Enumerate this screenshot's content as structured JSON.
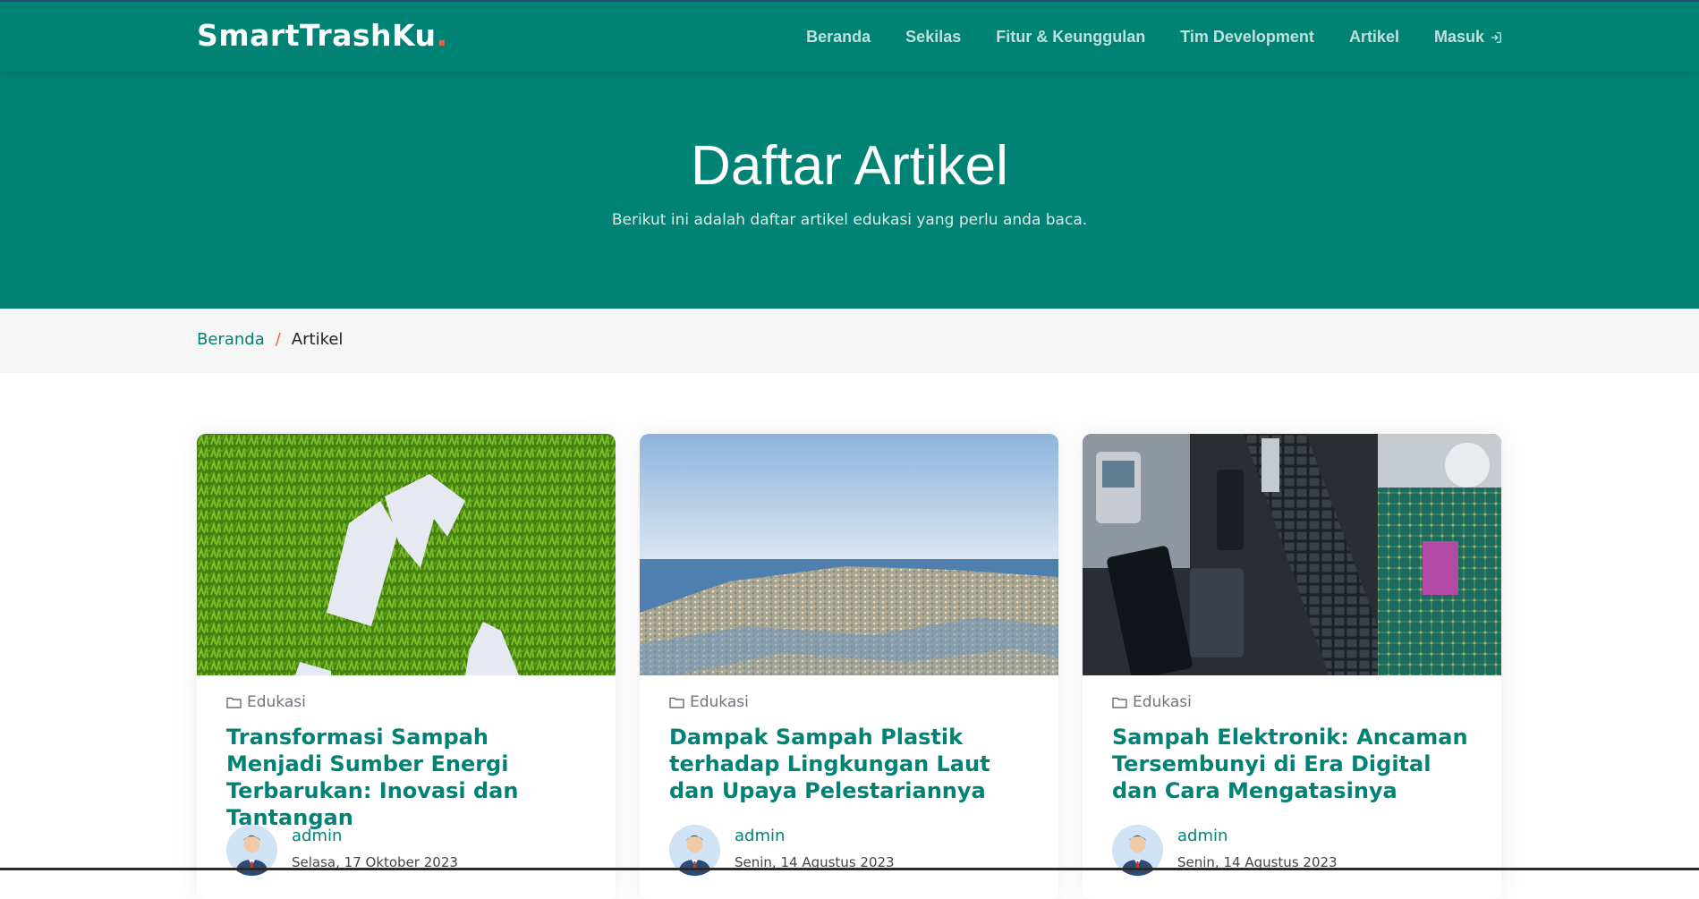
{
  "brand": {
    "name": "SmartTrashKu",
    "dot": ".",
    "accent": "#f85a40",
    "primary": "#008374"
  },
  "nav": {
    "items": [
      {
        "label": "Beranda"
      },
      {
        "label": "Sekilas"
      },
      {
        "label": "Fitur & Keunggulan"
      },
      {
        "label": "Tim Development"
      },
      {
        "label": "Artikel"
      },
      {
        "label": "Masuk",
        "icon": "login-icon"
      }
    ]
  },
  "hero": {
    "title": "Daftar Artikel",
    "subtitle": "Berikut ini adalah daftar artikel edukasi yang perlu anda baca."
  },
  "breadcrumb": {
    "home": "Beranda",
    "separator": "/",
    "current": "Artikel"
  },
  "articles": [
    {
      "image": "recycle-symbol-on-grass-image",
      "category": "Edukasi",
      "title": "Transformasi Sampah Menjadi Sumber Energi Terbarukan: Inovasi dan Tantangan",
      "author": "admin",
      "date": "Selasa, 17 Oktober 2023"
    },
    {
      "image": "ocean-plastic-waste-image",
      "category": "Edukasi",
      "title": "Dampak Sampah Plastik terhadap Lingkungan Laut dan Upaya Pelestariannya",
      "author": "admin",
      "date": "Senin, 14 Agustus 2023"
    },
    {
      "image": "electronic-waste-pile-image",
      "category": "Edukasi",
      "title": "Sampah Elektronik: Ancaman Tersembunyi di Era Digital dan Cara Mengatasinya",
      "author": "admin",
      "date": "Senin, 14 Agustus 2023"
    }
  ]
}
